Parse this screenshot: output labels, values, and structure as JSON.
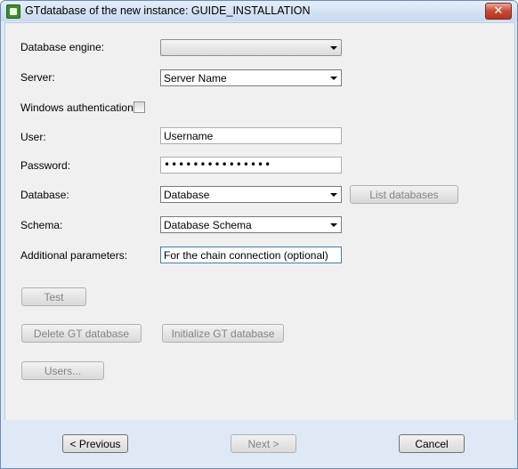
{
  "window": {
    "title": "GTdatabase of the new instance: GUIDE_INSTALLATION",
    "close_icon": "close-icon",
    "app_icon": "app-icon"
  },
  "form": {
    "engine": {
      "label": "Database engine:",
      "value": ""
    },
    "server": {
      "label": "Server:",
      "value": "Server Name"
    },
    "winauth": {
      "label": "Windows authentication"
    },
    "user": {
      "label": "User:",
      "value": "Username"
    },
    "password": {
      "label": "Password:",
      "value": "•••••••••••••••"
    },
    "database": {
      "label": "Database:",
      "value": "Database"
    },
    "schema": {
      "label": "Schema:",
      "value": "Database Schema"
    },
    "params": {
      "label": "Additional parameters:",
      "value": "For the chain connection (optional)"
    }
  },
  "buttons": {
    "list_databases": "List databases",
    "test": "Test",
    "delete_gt": "Delete GT database",
    "initialize_gt": "Initialize GT database",
    "users": "Users...",
    "previous": "< Previous",
    "next": "Next >",
    "cancel": "Cancel"
  }
}
